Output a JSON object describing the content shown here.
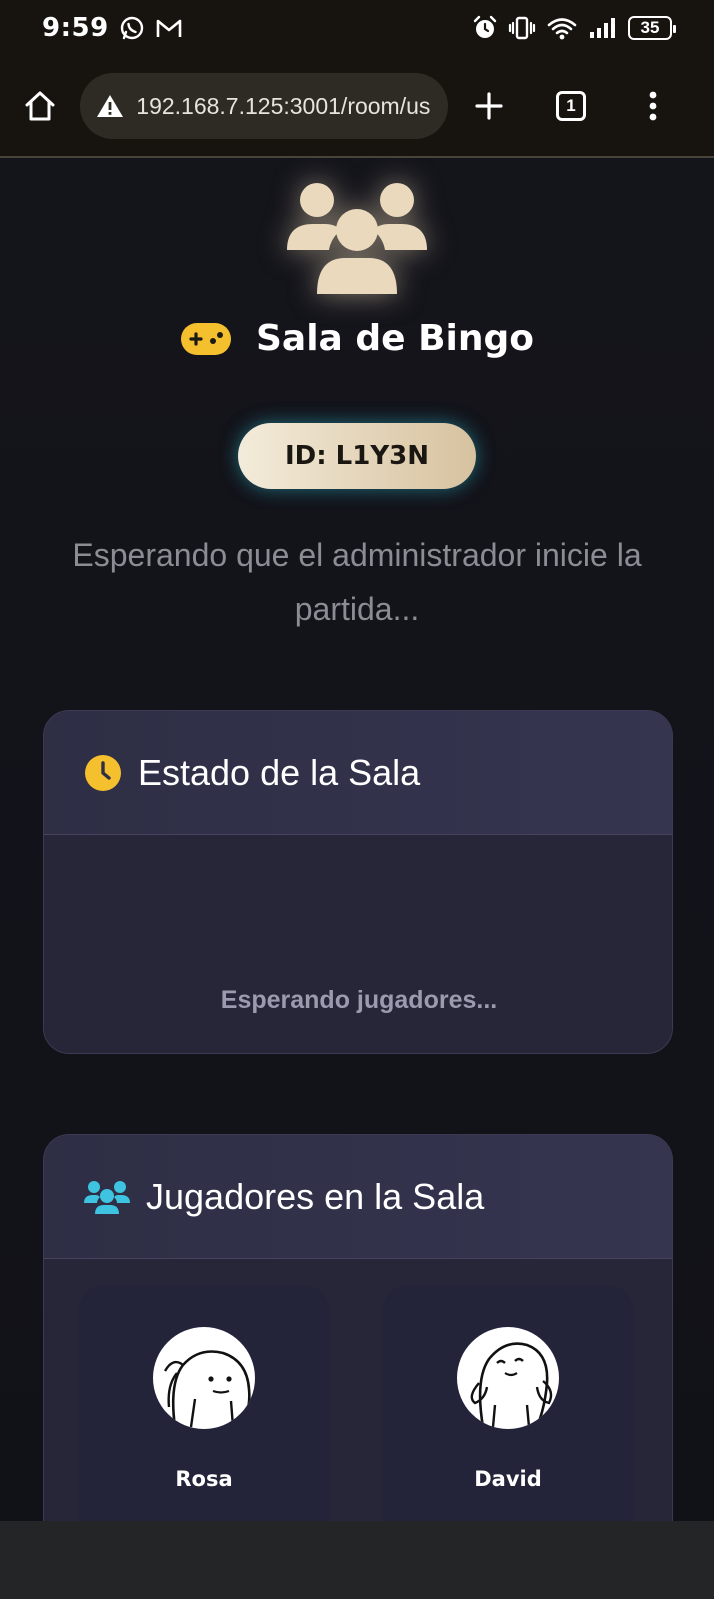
{
  "status_bar": {
    "time": "9:59",
    "battery": "35",
    "icons": [
      "whatsapp-icon",
      "gmail-icon",
      "alarm-icon",
      "vibrate-icon",
      "wifi-icon",
      "signal-icon"
    ]
  },
  "browser": {
    "url": "192.168.7.125:3001/room/us",
    "tab_count": "1"
  },
  "room": {
    "title": "Sala de Bingo",
    "id_label": "ID: L1Y3N",
    "waiting_message": "Esperando que el administrador inicie la partida..."
  },
  "status_card": {
    "title": "Estado de la Sala",
    "status_text": "Esperando jugadores..."
  },
  "players_card": {
    "title": "Jugadores en la Sala",
    "players": [
      {
        "name": "Rosa"
      },
      {
        "name": "David"
      }
    ]
  },
  "colors": {
    "accent_gold": "#f5c02d",
    "accent_cyan": "#3ec3e0",
    "badge_start": "#f3ebda",
    "badge_end": "#d7c29f"
  }
}
